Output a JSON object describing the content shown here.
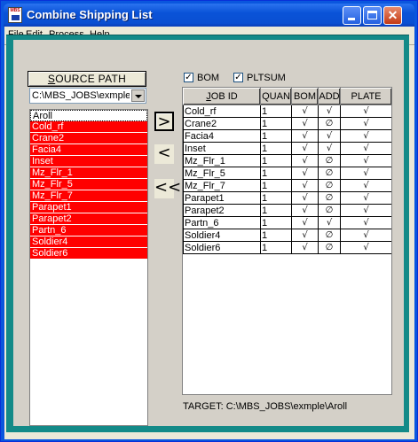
{
  "window": {
    "title": "Combine Shipping List",
    "app_icon_text": "MBS",
    "controls": {
      "minimize": "minimize",
      "maximize": "maximize",
      "close": "✕"
    }
  },
  "menu": [
    {
      "label": "File"
    },
    {
      "label": "Edit"
    },
    {
      "label": "Process"
    },
    {
      "label": "Help"
    }
  ],
  "source": {
    "button_label": "SOURCE PATH",
    "path_value": "C:\\MBS_JOBS\\exmple",
    "items": [
      {
        "label": "Aroll",
        "selected": false
      },
      {
        "label": "Cold_rf",
        "selected": true
      },
      {
        "label": "Crane2",
        "selected": true
      },
      {
        "label": "Facia4",
        "selected": true
      },
      {
        "label": "Inset",
        "selected": true
      },
      {
        "label": "Mz_Flr_1",
        "selected": true
      },
      {
        "label": "Mz_Flr_5",
        "selected": true
      },
      {
        "label": "Mz_Flr_7",
        "selected": true
      },
      {
        "label": "Parapet1",
        "selected": true
      },
      {
        "label": "Parapet2",
        "selected": true
      },
      {
        "label": "Partn_6",
        "selected": true
      },
      {
        "label": "Soldier4",
        "selected": true
      },
      {
        "label": "Soldier6",
        "selected": true
      }
    ]
  },
  "transfer_buttons": {
    "add": ">",
    "remove": "<",
    "remove_all": "<<"
  },
  "options": {
    "bom": {
      "label": "BOM",
      "checked": true
    },
    "pltsum": {
      "label": "PLTSUM",
      "checked": true
    }
  },
  "jobs_table": {
    "headers": [
      "JOB ID",
      "QUAN",
      "BOM",
      "ADD",
      "PLATE"
    ],
    "rows": [
      {
        "job": "Cold_rf",
        "quan": "1",
        "bom": "√",
        "add": "√",
        "plate": "√"
      },
      {
        "job": "Crane2",
        "quan": "1",
        "bom": "√",
        "add": "∅",
        "plate": "√"
      },
      {
        "job": "Facia4",
        "quan": "1",
        "bom": "√",
        "add": "√",
        "plate": "√"
      },
      {
        "job": "Inset",
        "quan": "1",
        "bom": "√",
        "add": "√",
        "plate": "√"
      },
      {
        "job": "Mz_Flr_1",
        "quan": "1",
        "bom": "√",
        "add": "∅",
        "plate": "√"
      },
      {
        "job": "Mz_Flr_5",
        "quan": "1",
        "bom": "√",
        "add": "∅",
        "plate": "√"
      },
      {
        "job": "Mz_Flr_7",
        "quan": "1",
        "bom": "√",
        "add": "∅",
        "plate": "√"
      },
      {
        "job": "Parapet1",
        "quan": "1",
        "bom": "√",
        "add": "∅",
        "plate": "√"
      },
      {
        "job": "Parapet2",
        "quan": "1",
        "bom": "√",
        "add": "∅",
        "plate": "√"
      },
      {
        "job": "Partn_6",
        "quan": "1",
        "bom": "√",
        "add": "√",
        "plate": "√"
      },
      {
        "job": "Soldier4",
        "quan": "1",
        "bom": "√",
        "add": "∅",
        "plate": "√"
      },
      {
        "job": "Soldier6",
        "quan": "1",
        "bom": "√",
        "add": "∅",
        "plate": "√"
      }
    ]
  },
  "target": "TARGET: C:\\MBS_JOBS\\exmple\\Aroll",
  "colors": {
    "selection": "#ff0000",
    "frame": "#138a88",
    "titlebar": "#0a53d8",
    "panel": "#d4d0c8"
  }
}
